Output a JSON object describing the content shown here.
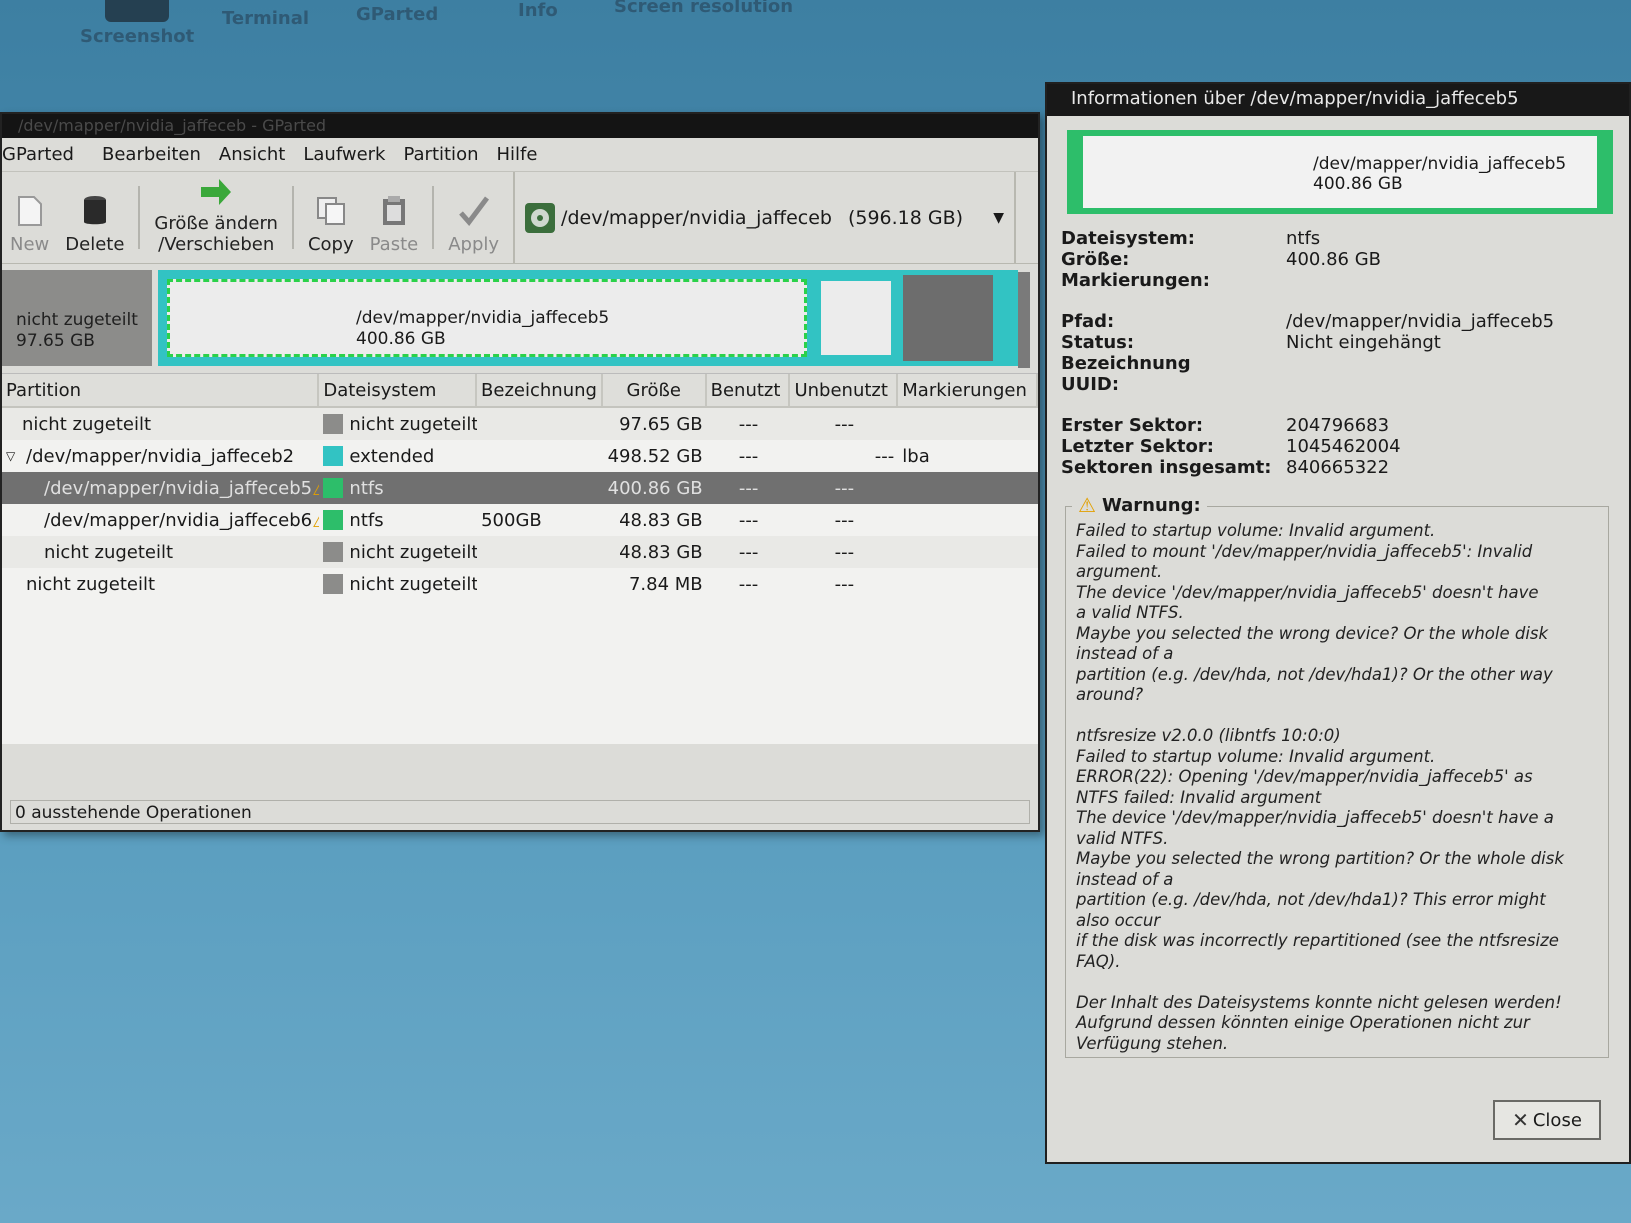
{
  "desktop": {
    "icons": [
      "Screenshot",
      "Terminal",
      "GParted",
      "Info",
      "Screen resolution"
    ]
  },
  "main_window": {
    "title": "/dev/mapper/nvidia_jaffeceb - GParted",
    "menu": [
      "GParted",
      "Bearbeiten",
      "Ansicht",
      "Laufwerk",
      "Partition",
      "Hilfe"
    ],
    "toolbar": {
      "new": "New",
      "delete": "Delete",
      "resize": "Größe ändern\n/Verschieben",
      "copy": "Copy",
      "paste": "Paste",
      "apply": "Apply"
    },
    "device": {
      "path": "/dev/mapper/nvidia_jaffeceb",
      "size": "(596.18 GB)"
    },
    "map": {
      "unalloc_label": "nicht zugeteilt",
      "unalloc_size": "97.65 GB",
      "selected_path": "/dev/mapper/nvidia_jaffeceb5",
      "selected_size": "400.86 GB"
    },
    "columns": [
      "Partition",
      "Dateisystem",
      "Bezeichnung",
      "Größe",
      "Benutzt",
      "Unbenutzt",
      "Markierungen"
    ],
    "rows": [
      {
        "partition": "nicht zugeteilt",
        "fs": "nicht zugeteilt",
        "label": "",
        "size": "97.65 GB",
        "used": "---",
        "unused": "---",
        "flags": ""
      },
      {
        "partition": "/dev/mapper/nvidia_jaffeceb2",
        "fs": "extended",
        "label": "",
        "size": "498.52 GB",
        "used": "---",
        "unused": "---",
        "flags": "lba"
      },
      {
        "partition": "/dev/mapper/nvidia_jaffeceb5",
        "fs": "ntfs",
        "label": "",
        "size": "400.86 GB",
        "used": "---",
        "unused": "---",
        "flags": ""
      },
      {
        "partition": "/dev/mapper/nvidia_jaffeceb6",
        "fs": "ntfs",
        "label": "500GB",
        "size": "48.83 GB",
        "used": "---",
        "unused": "---",
        "flags": ""
      },
      {
        "partition": "nicht zugeteilt",
        "fs": "nicht zugeteilt",
        "label": "",
        "size": "48.83 GB",
        "used": "---",
        "unused": "---",
        "flags": ""
      },
      {
        "partition": "nicht zugeteilt",
        "fs": "nicht zugeteilt",
        "label": "",
        "size": "7.84 MB",
        "used": "---",
        "unused": "---",
        "flags": ""
      }
    ],
    "status": "0 ausstehende Operationen"
  },
  "info_dialog": {
    "title": "Informationen über /dev/mapper/nvidia_jaffeceb5",
    "map_path": "/dev/mapper/nvidia_jaffeceb5",
    "map_size": "400.86 GB",
    "fields": {
      "fs_key": "Dateisystem:",
      "fs_val": "ntfs",
      "size_key": "Größe:",
      "size_val": "400.86 GB",
      "flags_key": "Markierungen:",
      "flags_val": "",
      "path_key": "Pfad:",
      "path_val": "/dev/mapper/nvidia_jaffeceb5",
      "status_key": "Status:",
      "status_val": "Nicht eingehängt",
      "label_key": "Bezeichnung",
      "label_val": "",
      "uuid_key": "UUID:",
      "uuid_val": "",
      "first_key": "Erster Sektor:",
      "first_val": "204796683",
      "last_key": "Letzter Sektor:",
      "last_val": "1045462004",
      "total_key": "Sektoren insgesamt:",
      "total_val": "840665322"
    },
    "warning_title": "Warnung:",
    "warning_text": "Failed to startup volume: Invalid argument.\nFailed to mount '/dev/mapper/nvidia_jaffeceb5': Invalid\nargument.\nThe device '/dev/mapper/nvidia_jaffeceb5' doesn't have\na valid NTFS.\nMaybe you selected the wrong device? Or the whole disk\ninstead of a\npartition (e.g. /dev/hda, not /dev/hda1)? Or the other way\naround?\n\nntfsresize v2.0.0 (libntfs 10:0:0)\nFailed to startup volume: Invalid argument.\nERROR(22): Opening '/dev/mapper/nvidia_jaffeceb5' as\nNTFS failed: Invalid argument\nThe device '/dev/mapper/nvidia_jaffeceb5' doesn't have a\nvalid NTFS.\nMaybe you selected the wrong partition? Or the whole disk\ninstead of a\npartition (e.g. /dev/hda, not /dev/hda1)? This error might\nalso occur\nif the disk was incorrectly repartitioned (see the ntfsresize\nFAQ).\n\nDer Inhalt des Dateisystems konnte nicht gelesen werden!\nAufgrund dessen könnten einige Operationen nicht zur\nVerfügung stehen.",
    "close": "Close"
  },
  "colors": {
    "unallocated": "#8c8c8a",
    "extended": "#32c3c3",
    "ntfs": "#2dbe6a",
    "selected_row": "#707070",
    "warning": "#e2a000"
  }
}
